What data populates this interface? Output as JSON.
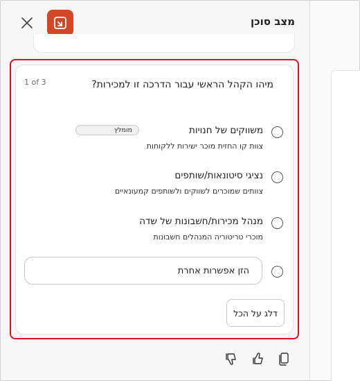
{
  "header": {
    "title": "מצב סוכן",
    "close_icon": "close-icon",
    "app_icon": "powerpoint-app-icon",
    "brand_color": "#d24726"
  },
  "question_card": {
    "question": "מיהו הקהל הראשי עבור הדרכה זו למכירות?",
    "counter": "1 of 3",
    "highlight_color": "#e0101f",
    "options": [
      {
        "label": "משווקים של חנויות",
        "description": "צוות קו החזית מוכר ישירות ללקוחות",
        "badge": "מומלץ"
      },
      {
        "label": "נציגי סיטונאות/שותפים",
        "description": "צוותים שמוכרים לשווקים ולשותפים קמעונאיים"
      },
      {
        "label": "מנהל מכירות/חשבונות של שדה",
        "description": "מוכרי טריטוריה המנהלים חשבונות"
      }
    ],
    "other_placeholder": "הזן אפשרות אחרת",
    "skip_label": "דלג על הכל"
  },
  "footer": {
    "icons": [
      "thumbs-down-icon",
      "thumbs-up-icon",
      "copy-icon"
    ]
  }
}
